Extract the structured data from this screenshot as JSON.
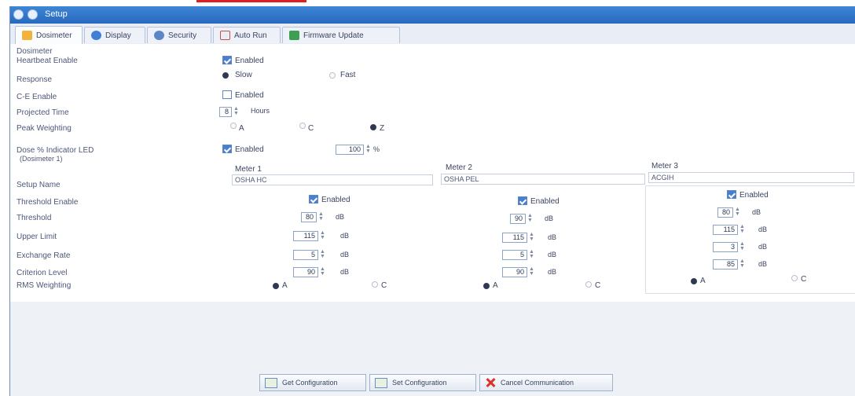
{
  "window": {
    "title": "Setup"
  },
  "tabs": [
    {
      "label": "Dosimeter",
      "icon": "wrench-icon",
      "active": true
    },
    {
      "label": "Display",
      "icon": "display-icon",
      "active": false
    },
    {
      "label": "Security",
      "icon": "security-icon",
      "active": false
    },
    {
      "label": "Auto Run",
      "icon": "calendar-icon",
      "active": false
    },
    {
      "label": "Firmware Update",
      "icon": "firmware-icon",
      "active": false
    }
  ],
  "section_label": "Dosimeter",
  "settings": {
    "heartbeat": {
      "label": "Heartbeat Enable",
      "value": "Enabled",
      "checked": true
    },
    "response": {
      "label": "Response",
      "options": [
        "Slow",
        "Fast"
      ],
      "selected": "Slow"
    },
    "cd_enable": {
      "label": "C-E Enable",
      "value": "Enabled",
      "checked": false
    },
    "projected_time": {
      "label": "Projected Time",
      "value": "8",
      "unit": "Hours"
    },
    "peak_weighting": {
      "label": "Peak Weighting",
      "options": [
        "A",
        "C",
        "Z"
      ],
      "selected": "Z"
    },
    "dose_led": {
      "label": "Dose % Indicator LED",
      "sublabel": "(Dosimeter 1)",
      "value": "Enabled",
      "checked": true,
      "amount": "100",
      "unit": "%"
    }
  },
  "meter_rows": {
    "setup_name": "Setup Name",
    "threshold_enable": "Threshold Enable",
    "threshold": "Threshold",
    "upper_limit": "Upper Limit",
    "exchange_rate": "Exchange Rate",
    "criterion_level": "Criterion Level",
    "weighting": "RMS Weighting"
  },
  "meters": [
    {
      "title": "Meter 1",
      "name": "OSHA HC",
      "enabled_label": "Enabled",
      "threshold": "80",
      "upper_limit": "115",
      "exchange_rate": "5",
      "criterion": "90",
      "unit": "dB",
      "weight_options": [
        "A",
        "C"
      ],
      "weight_selected": "A"
    },
    {
      "title": "Meter 2",
      "name": "OSHA PEL",
      "enabled_label": "Enabled",
      "threshold": "90",
      "upper_limit": "115",
      "exchange_rate": "5",
      "criterion": "90",
      "unit": "dB",
      "weight_options": [
        "A",
        "C"
      ],
      "weight_selected": "A"
    },
    {
      "title": "Meter 3",
      "name": "ACGIH",
      "enabled_label": "Enabled",
      "threshold": "80",
      "upper_limit": "115",
      "exchange_rate": "3",
      "criterion": "85",
      "unit": "dB",
      "weight_options": [
        "A",
        "C"
      ],
      "weight_selected": "A"
    }
  ],
  "buttons": {
    "get_config": "Get Configuration",
    "set_config": "Set Configuration",
    "cancel": "Cancel Communication"
  },
  "colors": {
    "titlebar": "#2f74c8",
    "accent": "#4a7fd0",
    "cancel": "#d9342b"
  }
}
